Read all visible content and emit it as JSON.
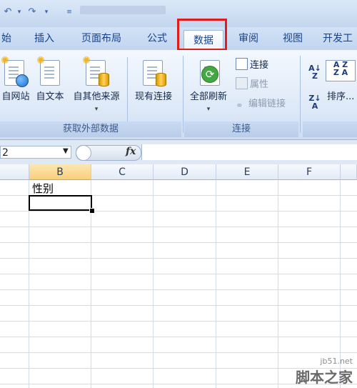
{
  "quick_access": {
    "undo_icon": "undo-icon",
    "redo_icon": "redo-icon",
    "customize_icon": "customize-icon"
  },
  "tabs": [
    {
      "label": "始"
    },
    {
      "label": "插入"
    },
    {
      "label": "页面布局"
    },
    {
      "label": "公式"
    },
    {
      "label": "数据",
      "active": true
    },
    {
      "label": "审阅"
    },
    {
      "label": "视图"
    },
    {
      "label": "开发工"
    }
  ],
  "ribbon": {
    "external_data": {
      "group_label": "获取外部数据",
      "from_web": "自网站",
      "from_text": "自文本",
      "from_other": "自其他来源",
      "existing_connections": "现有连接"
    },
    "connections": {
      "group_label": "连接",
      "refresh_all": "全部刷新",
      "connections": "连接",
      "properties": "属性",
      "edit_links": "编辑链接"
    },
    "sort": {
      "sort_label": "排序..."
    }
  },
  "formula_bar": {
    "name_box": "2",
    "fx": "fx",
    "formula": ""
  },
  "columns": [
    "",
    "B",
    "C",
    "D",
    "E",
    "F"
  ],
  "selected_column": "B",
  "cells": {
    "B1": "性别"
  },
  "watermark": {
    "url": "jb51.net",
    "name": "脚本之家"
  },
  "colors": {
    "highlight": "#e21b1b",
    "accent": "#15428b"
  }
}
